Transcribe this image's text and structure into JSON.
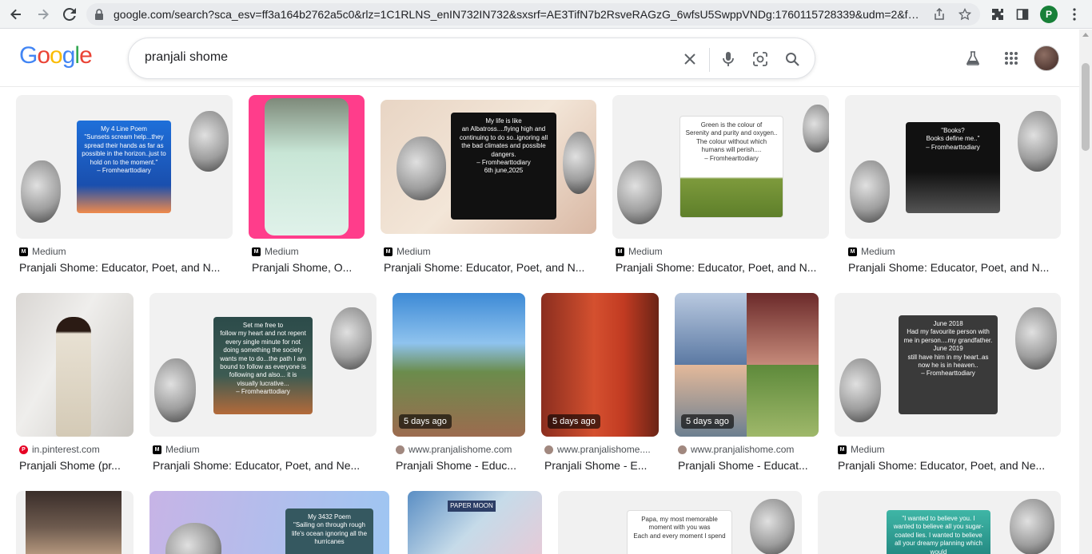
{
  "browser": {
    "url": "google.com/search?sca_esv=ff3a164b2762a5c0&rlz=1C1RLNS_enIN732IN732&sxsrf=AE3TifN7b2RsveRAGzG_6wfsU5SwppVNDg:1760115728339&udm=2&fbs=AI...",
    "profile_letter": "P"
  },
  "google": {
    "logo": [
      "G",
      "o",
      "o",
      "g",
      "l",
      "e"
    ],
    "logo_colors": [
      "#4285F4",
      "#EA4335",
      "#FBBC05",
      "#4285F4",
      "#34A853",
      "#EA4335"
    ],
    "query": "pranjali shome"
  },
  "results": [
    {
      "source": "Medium",
      "fav": "medium",
      "title": "Pranjali Shome: Educator, Poet, and N...",
      "poem": "My 4 Line Poem\n\"Sunsets scream help...they spread their hands as far as possible in the horizon..just to hold on to the moment.\"\n– Fromhearttodiary",
      "badge": ""
    },
    {
      "source": "Medium",
      "fav": "medium",
      "title": "Pranjali Shome, O...",
      "poem": "",
      "badge": ""
    },
    {
      "source": "Medium",
      "fav": "medium",
      "title": "Pranjali Shome: Educator, Poet, and N...",
      "poem": "My life is like\nan Albatross....flying high and continuing to do so..ignoring all the bad climates and possible dangers.\n– Fromhearttodiary\n6th june,2025",
      "badge": ""
    },
    {
      "source": "Medium",
      "fav": "medium",
      "title": "Pranjali Shome: Educator, Poet, and N...",
      "poem": "Green is the colour of\nSerenity and purity and oxygen.. The colour without which humans will perish....\n– Fromhearttodiary",
      "badge": ""
    },
    {
      "source": "Medium",
      "fav": "medium",
      "title": "Pranjali Shome: Educator, Poet, and N...",
      "poem": "\"Books?\nBooks define me..\"\n– Fromhearttodiary",
      "badge": ""
    },
    {
      "source": "in.pinterest.com",
      "fav": "pin",
      "title": "Pranjali Shome (pr...",
      "poem": "",
      "badge": ""
    },
    {
      "source": "Medium",
      "fav": "medium",
      "title": "Pranjali Shome: Educator, Poet, and Ne...",
      "poem": "Set me free to\nfollow my heart and not repent every single minute for not doing something the society wants me to do...the path I am bound to follow as everyone is following and also... it is visually lucrative...\n– Fromhearttodiary",
      "badge": ""
    },
    {
      "source": "www.pranjalishome.com",
      "fav": "web",
      "title": "Pranjali Shome - Educ...",
      "poem": "",
      "badge": "5 days ago"
    },
    {
      "source": "www.pranjalishome....",
      "fav": "web",
      "title": "Pranjali Shome - E...",
      "poem": "",
      "badge": "5 days ago"
    },
    {
      "source": "www.pranjalishome.com",
      "fav": "web",
      "title": "Pranjali Shome - Educat...",
      "poem": "",
      "badge": "5 days ago"
    },
    {
      "source": "Medium",
      "fav": "medium",
      "title": "Pranjali Shome: Educator, Poet, and Ne...",
      "poem": "June 2018\nHad my favourite person with me in person....my grandfather.\nJune 2019\nstill have him in my heart..as now he is in heaven..\n– Fromhearttodiary",
      "badge": ""
    },
    {
      "source": "",
      "fav": "",
      "title": "",
      "poem": "",
      "badge": ""
    },
    {
      "source": "",
      "fav": "",
      "title": "",
      "poem": "My 3432 Poem\n\"Sailing on through rough life's ocean ignoring all the hurricanes",
      "badge": ""
    },
    {
      "source": "",
      "fav": "",
      "title": "",
      "poem": "PAPER MOON",
      "badge": ""
    },
    {
      "source": "",
      "fav": "",
      "title": "",
      "poem": "Papa, my most memorable moment with you was\nEach and every moment I spend",
      "badge": ""
    },
    {
      "source": "",
      "fav": "",
      "title": "",
      "poem": "\"I wanted to believe you. I wanted to believe all you sugar-coated lies. I wanted to believe all your dreamy planning which would",
      "badge": ""
    }
  ]
}
